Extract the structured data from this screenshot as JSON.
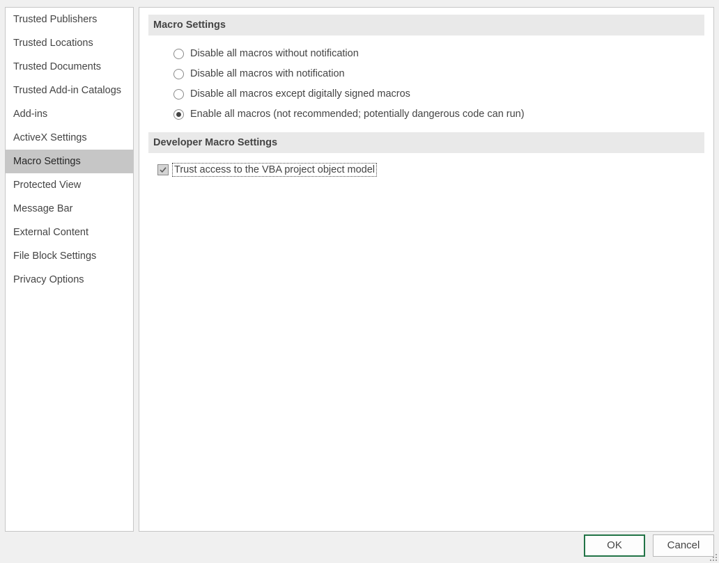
{
  "sidebar": {
    "items": [
      {
        "label": "Trusted Publishers",
        "selected": false
      },
      {
        "label": "Trusted Locations",
        "selected": false
      },
      {
        "label": "Trusted Documents",
        "selected": false
      },
      {
        "label": "Trusted Add-in Catalogs",
        "selected": false
      },
      {
        "label": "Add-ins",
        "selected": false
      },
      {
        "label": "ActiveX Settings",
        "selected": false
      },
      {
        "label": "Macro Settings",
        "selected": true
      },
      {
        "label": "Protected View",
        "selected": false
      },
      {
        "label": "Message Bar",
        "selected": false
      },
      {
        "label": "External Content",
        "selected": false
      },
      {
        "label": "File Block Settings",
        "selected": false
      },
      {
        "label": "Privacy Options",
        "selected": false
      }
    ]
  },
  "macro_settings": {
    "header": "Macro Settings",
    "options": [
      {
        "label": "Disable all macros without notification",
        "selected": false
      },
      {
        "label": "Disable all macros with notification",
        "selected": false
      },
      {
        "label": "Disable all macros except digitally signed macros",
        "selected": false
      },
      {
        "label": "Enable all macros (not recommended; potentially dangerous code can run)",
        "selected": true
      }
    ]
  },
  "developer_settings": {
    "header": "Developer Macro Settings",
    "trust_vba_label": "Trust access to the VBA project object model",
    "trust_vba_checked": true
  },
  "buttons": {
    "ok_label": "OK",
    "cancel_label": "Cancel"
  },
  "colors": {
    "accent": "#217346",
    "selected_bg": "#c6c6c6",
    "header_bg": "#e9e9e9"
  }
}
